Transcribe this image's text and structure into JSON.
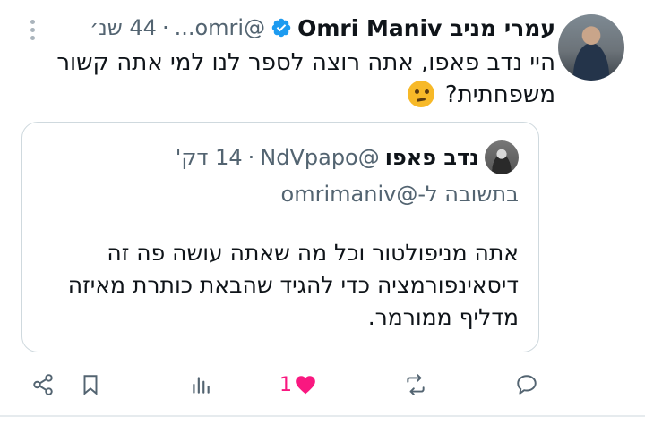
{
  "tweet": {
    "author_name": "עמרי מניב Omri Maniv",
    "handle": "@omri...",
    "separator": "·",
    "time": "44 שנ׳",
    "text": "היי נדב פאפו, אתה רוצה לספר לנו למי אתה קשור משפחתית?",
    "emoji": "thinking-face"
  },
  "quoted": {
    "author_name": "נדב פאפו",
    "handle": "@NdVpapo",
    "separator": "·",
    "time": "14 דק'",
    "reply_to": "בתשובה ל-@omrimaniv",
    "text": "אתה מניפולטור וכל מה שאתה עושה פה זה דיסאינפורמציה כדי להגיד שהבאת כותרת מאיזה מדליף ממורמר."
  },
  "actions": {
    "like_count": "1",
    "like_color": "#f91880",
    "icon_color": "#536471"
  }
}
